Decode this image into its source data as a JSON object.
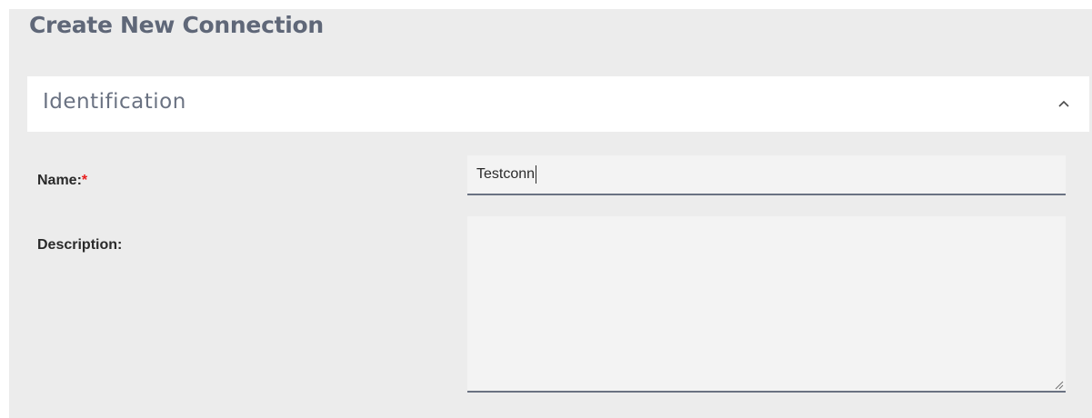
{
  "header": {
    "title": "Create New Connection"
  },
  "section": {
    "title": "Identification",
    "expanded": true,
    "toggle_icon": "chevron-up-icon"
  },
  "fields": {
    "name": {
      "label": "Name:",
      "required_marker": "*",
      "value": "Testconn"
    },
    "description": {
      "label": "Description:",
      "value": ""
    }
  },
  "colors": {
    "page_background": "#ececec",
    "section_background": "#ffffff",
    "title_text": "#5f6778",
    "input_background": "#f3f3f3",
    "input_underline": "#6a7282",
    "required": "#e81c1c"
  }
}
